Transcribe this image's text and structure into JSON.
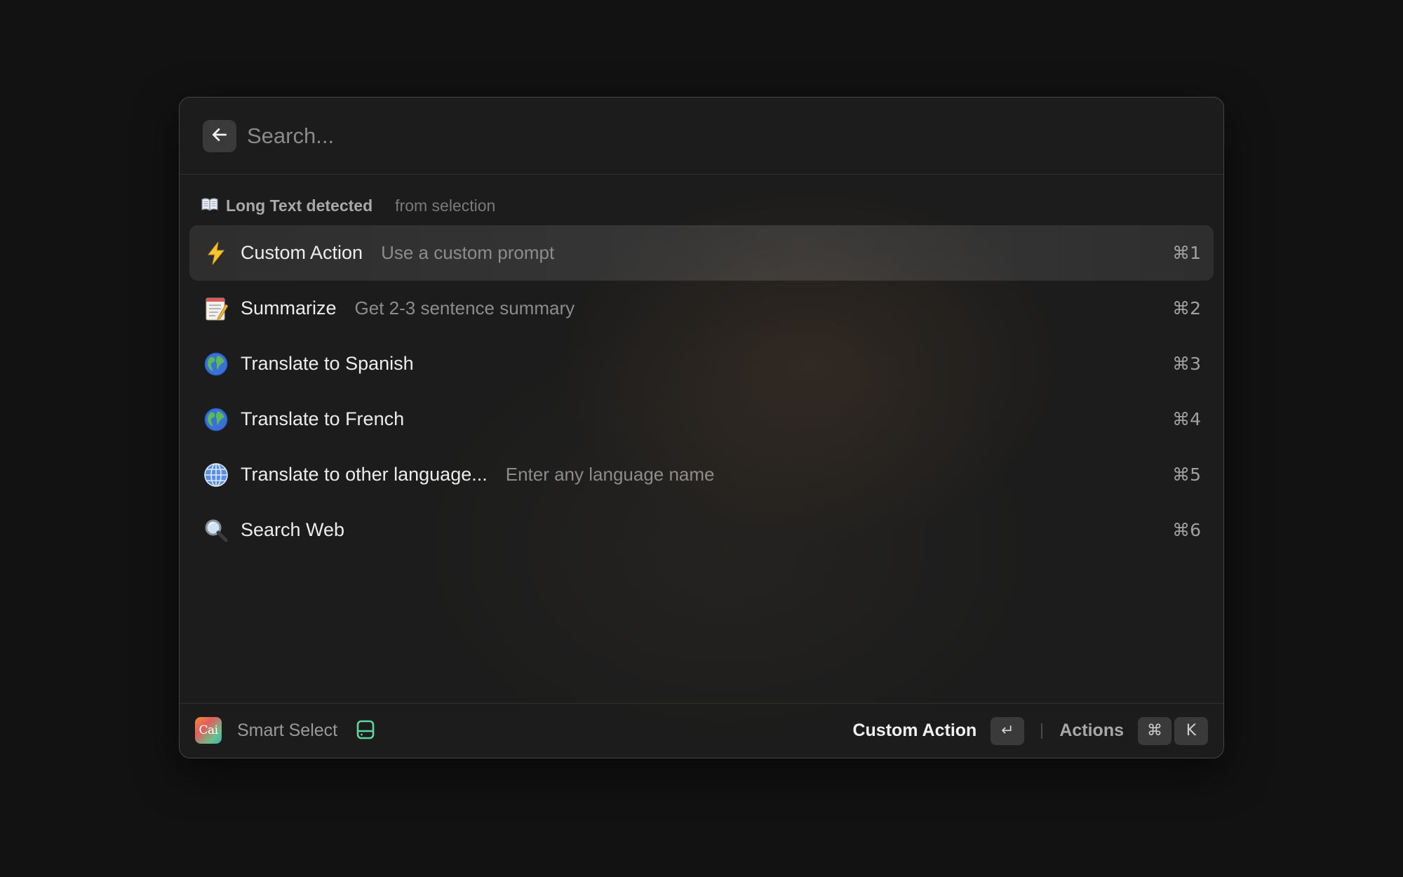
{
  "search": {
    "placeholder": "Search..."
  },
  "section": {
    "icon": "open-book-icon",
    "title": "Long Text detected",
    "subtitle": "from selection"
  },
  "items": [
    {
      "icon": "lightning-icon",
      "title": "Custom Action",
      "subtitle": "Use a custom prompt",
      "shortcut": "⌘1",
      "selected": true
    },
    {
      "icon": "memo-icon",
      "title": "Summarize",
      "subtitle": "Get 2-3 sentence summary",
      "shortcut": "⌘2",
      "selected": false
    },
    {
      "icon": "globe-europe-africa-icon",
      "title": "Translate to Spanish",
      "subtitle": "",
      "shortcut": "⌘3",
      "selected": false
    },
    {
      "icon": "globe-europe-africa-icon",
      "title": "Translate to French",
      "subtitle": "",
      "shortcut": "⌘4",
      "selected": false
    },
    {
      "icon": "globe-meridians-icon",
      "title": "Translate to other language...",
      "subtitle": "Enter any language name",
      "shortcut": "⌘5",
      "selected": false
    },
    {
      "icon": "magnifying-glass-icon",
      "title": "Search Web",
      "subtitle": "",
      "shortcut": "⌘6",
      "selected": false
    }
  ],
  "footer": {
    "logo_text": "Cai",
    "label": "Smart Select",
    "drive_icon": "drive-icon",
    "primary_action": "Custom Action",
    "enter_key": "↵",
    "secondary_action": "Actions",
    "cmd_key": "⌘",
    "k_key": "K"
  },
  "colors": {
    "background": "#121212",
    "window": "#1c1c1c",
    "accent_green": "#5fd6a0"
  }
}
